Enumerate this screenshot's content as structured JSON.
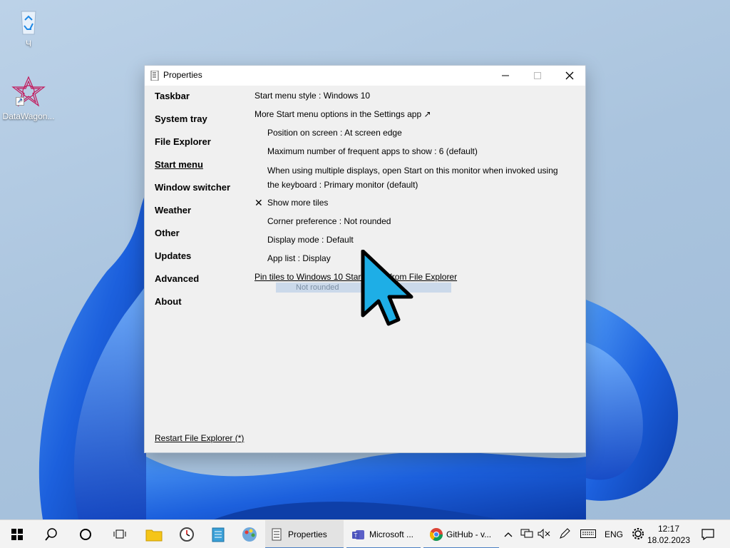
{
  "desktop": {
    "icons": [
      {
        "label": "Ч",
        "icon": "recycle-bin-icon"
      },
      {
        "label": "DataWagon...",
        "icon": "datawagon-app-icon"
      }
    ]
  },
  "window": {
    "title": "Properties",
    "nav": [
      "Taskbar",
      "System tray",
      "File Explorer",
      "Start menu",
      "Window switcher",
      "Weather",
      "Other",
      "Updates",
      "Advanced",
      "About"
    ],
    "active_nav": "Start menu",
    "settings": {
      "start_menu_style": "Start menu style : Windows 10",
      "more_options": "More Start menu options in the Settings app ↗",
      "position": "Position on screen : At screen edge",
      "max_frequent": "Maximum number of frequent apps to show : 6 (default)",
      "multi_display": "When using multiple displays, open Start on this monitor when invoked using the keyboard : Primary monitor (default)",
      "show_more_tiles": "Show more tiles",
      "show_more_tiles_checked": true,
      "corner_preference": "Corner preference : Not rounded",
      "display_mode": "Display mode : Default",
      "app_list": "App list : Display",
      "dropdown_ghost": "Not rounded",
      "pin_tiles": "Pin tiles to Windows 10 Start menu from File Explorer"
    },
    "restart_link": "Restart File Explorer (*)"
  },
  "taskbar": {
    "tasks": [
      {
        "label": "Properties",
        "icon": "properties-icon"
      },
      {
        "label": "Microsoft ...",
        "icon": "teams-icon"
      },
      {
        "label": "GitHub - v...",
        "icon": "chrome-icon"
      }
    ],
    "language": "ENG",
    "time": "12:17",
    "date": "18.02.2023"
  },
  "colors": {
    "accent": "#4a7fc3",
    "cursor_fill": "#1eaee6",
    "wallpaper_blue": "#1a5fd8"
  }
}
